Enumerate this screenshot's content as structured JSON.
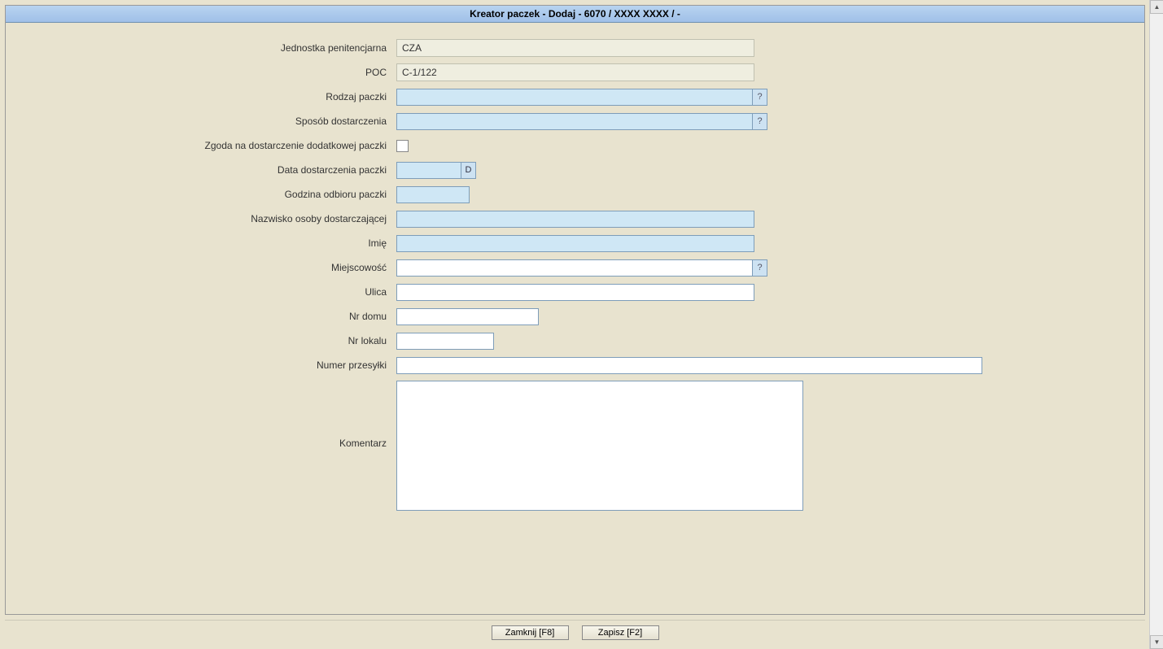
{
  "title": "Kreator paczek - Dodaj - 6070 / XXXX XXXX / -",
  "labels": {
    "jednostka": "Jednostka penitencjarna",
    "poc": "POC",
    "rodzaj": "Rodzaj paczki",
    "sposob": "Sposób dostarczenia",
    "zgoda": "Zgoda na dostarczenie dodatkowej paczki",
    "dataDost": "Data dostarczenia paczki",
    "godzina": "Godzina odbioru paczki",
    "nazwisko": "Nazwisko osoby dostarczającej",
    "imie": "Imię",
    "miejscowosc": "Miejscowość",
    "ulica": "Ulica",
    "nrDomu": "Nr domu",
    "nrLokalu": "Nr lokalu",
    "numerPrzesylki": "Numer przesyłki",
    "komentarz": "Komentarz"
  },
  "values": {
    "jednostka": "CZA",
    "poc": "C-1/122",
    "rodzaj": "",
    "sposob": "",
    "dataDost": "",
    "godzina": "",
    "nazwisko": "",
    "imie": "",
    "miejscowosc": "",
    "ulica": "",
    "nrDomu": "",
    "nrLokalu": "",
    "numerPrzesylki": "",
    "komentarz": ""
  },
  "icons": {
    "lookup": "?",
    "date": "D"
  },
  "buttons": {
    "close": "Zamknij [F8]",
    "save": "Zapisz [F2]"
  }
}
